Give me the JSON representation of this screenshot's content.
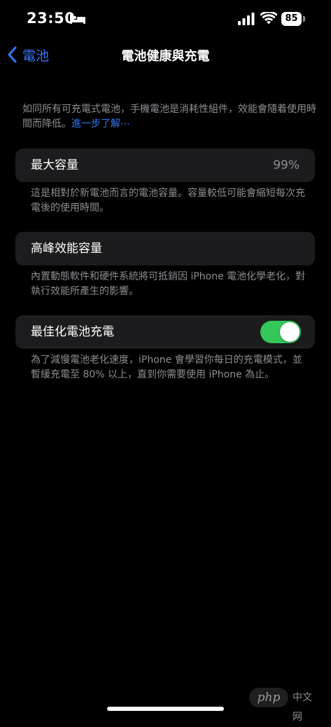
{
  "status_bar": {
    "time": "23:50",
    "battery_level": "85",
    "icons": [
      "bed-icon",
      "signal-icon",
      "wifi-icon",
      "battery-icon"
    ]
  },
  "nav": {
    "back_label": "電池",
    "title": "電池健康與充電"
  },
  "intro": {
    "text": "如同所有可充電式電池，手機電池是消耗性組件，效能會隨着使用時間而降低。",
    "link": "進一步了解⋯"
  },
  "max_capacity": {
    "label": "最大容量",
    "value": "99%",
    "footer": "這是相對於新電池而言的電池容量。容量較低可能會縮短每次充電後的使用時間。"
  },
  "peak_performance": {
    "label": "高峰效能容量",
    "footer": "內置動態軟件和硬件系統將可抵銷因 iPhone 電池化學老化，對執行效能所產生的影響。"
  },
  "optimized_charging": {
    "label": "最佳化電池充電",
    "enabled": true,
    "footer": "為了減慢電池老化速度，iPhone 會學習你每日的充電模式，並暫緩充電至 80% 以上，直到你需要使用 iPhone 為止。"
  },
  "watermark": {
    "logo": "php",
    "text": "中文网"
  },
  "colors": {
    "background": "#000000",
    "cell": "#1c1c1e",
    "accent": "#3478f6",
    "secondary_text": "#8e8e93",
    "toggle_on": "#34c759"
  }
}
